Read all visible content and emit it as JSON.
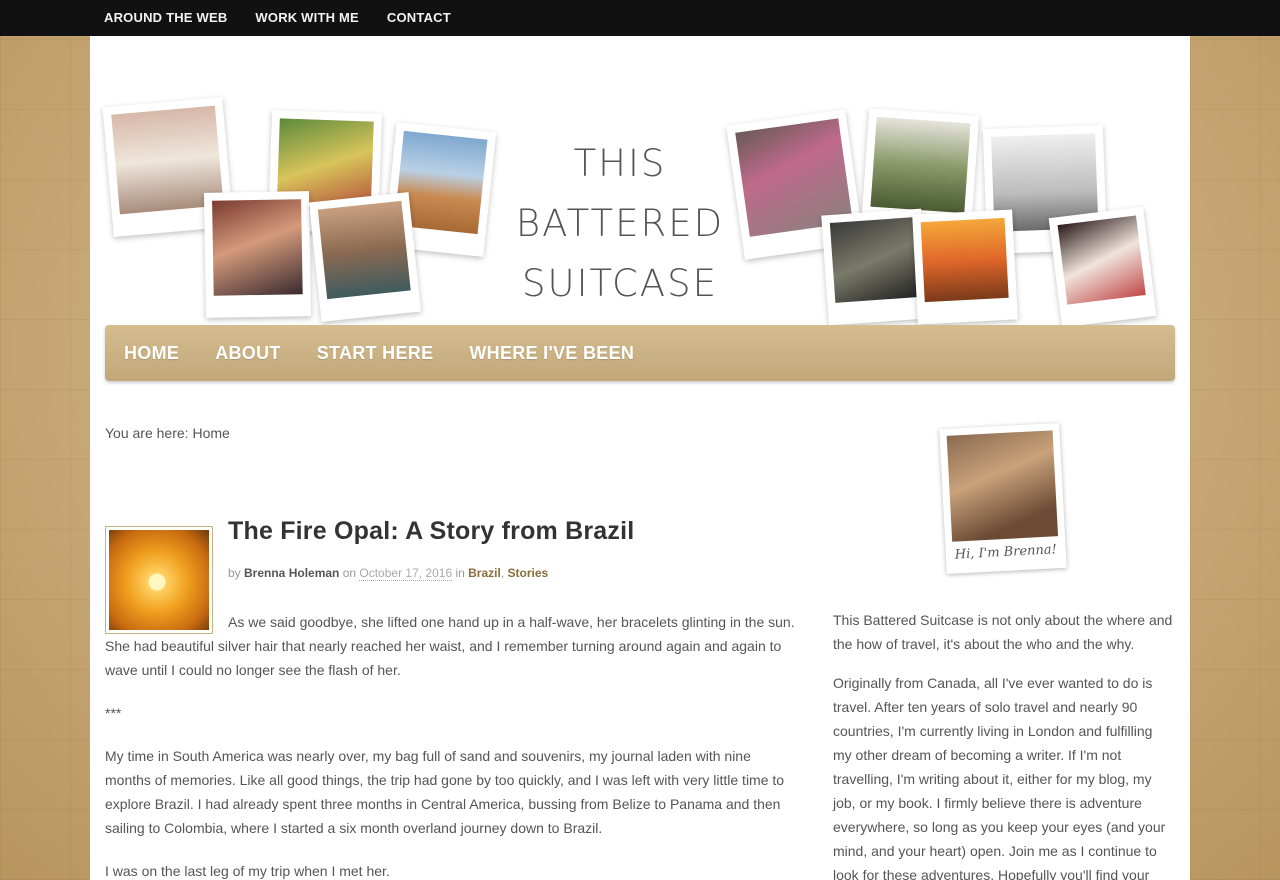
{
  "topnav": [
    "AROUND THE WEB",
    "WORK WITH ME",
    "CONTACT"
  ],
  "site": {
    "title_lines": [
      "THIS",
      "BATTERED",
      "SUITCASE"
    ]
  },
  "mainnav": [
    "HOME",
    "ABOUT",
    "START HERE",
    "WHERE I'VE BEEN"
  ],
  "breadcrumb": {
    "prefix": "You are here: ",
    "current": "Home"
  },
  "post": {
    "title": "The Fire Opal: A Story from Brazil",
    "by": "by ",
    "author": "Brenna Holeman",
    "on": " on ",
    "date": "October 17, 2016",
    "in": " in ",
    "category1": "Brazil",
    "sep": ", ",
    "category2": "Stories",
    "paragraphs": [
      "As we said goodbye, she lifted one hand up in a half-wave, her bracelets glinting in the sun. She had beautiful silver hair that nearly reached her waist, and I remember turning around again and again to wave until I could no longer see the flash of her.",
      "***",
      "My time in South America was nearly over, my bag full of sand and souvenirs, my journal laden with nine months of memories. Like all good things, the trip had gone by too quickly, and I was left with very little time to explore Brazil. I had already spent three months in Central America, bussing from Belize to Panama and then sailing to Colombia, where I started a six month overland journey down to Brazil.",
      "I was on the last leg of my trip when I met her."
    ]
  },
  "sidebar": {
    "caption": "Hi, I'm Brenna!",
    "about1": "This Battered Suitcase is not only about the where and the how of travel, it's about the who and the why.",
    "about2": "Originally from Canada, all I've ever wanted to do is travel. After ten years of solo travel and nearly 90 countries, I'm currently living in London and fulfilling my other dream of becoming a writer. If I'm not travelling, I'm writing about it, either for my blog, my job, or my book. I firmly believe there is adventure everywhere, so long as you keep your eyes (and your mind, and your heart) open. Join me as I continue to look for these adventures. Hopefully you'll find your"
  },
  "colors": {
    "topbar": "#111111",
    "nav": "#c9b184",
    "accent": "#8a6d3b"
  }
}
